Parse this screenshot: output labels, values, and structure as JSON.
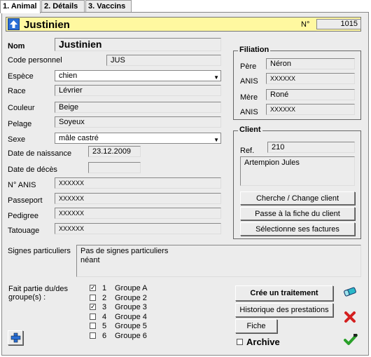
{
  "tabs": [
    {
      "label": "1. Animal"
    },
    {
      "label": "2. Détails"
    },
    {
      "label": "3. Vaccins"
    }
  ],
  "header": {
    "name": "Justinien",
    "number_label": "N°",
    "number_value": "1015"
  },
  "animal": {
    "nom_label": "Nom",
    "nom_value": "Justinien",
    "code_label": "Code personnel",
    "code_value": "JUS",
    "espece_label": "Espèce",
    "espece_value": "chien",
    "race_label": "Race",
    "race_value": "Lévrier",
    "couleur_label": "Couleur",
    "couleur_value": "Beige",
    "pelage_label": "Pelage",
    "pelage_value": "Soyeux",
    "sexe_label": "Sexe",
    "sexe_value": "mâle castré",
    "naissance_label": "Date de naissance",
    "naissance_value": "23.12.2009",
    "deces_label": "Date de décès",
    "deces_value": "",
    "anis_label": "N° ANIS",
    "anis_value": "XXXXXX",
    "passeport_label": "Passeport",
    "passeport_value": "XXXXXX",
    "pedigree_label": "Pedigree",
    "pedigree_value": "XXXXXX",
    "tatouage_label": "Tatouage",
    "tatouage_value": "XXXXXX"
  },
  "filiation": {
    "title": "Filiation",
    "pere_label": "Père",
    "pere_value": "Néron",
    "pere_anis_label": "ANIS",
    "pere_anis_value": "XXXXXX",
    "mere_label": "Mère",
    "mere_value": "Roné",
    "mere_anis_label": "ANIS",
    "mere_anis_value": "XXXXXX"
  },
  "client": {
    "title": "Client",
    "ref_label": "Ref.",
    "ref_value": "210",
    "name": "Artempion Jules",
    "btn_change": "Cherche / Change client",
    "btn_fiche": "Passe à la fiche du client",
    "btn_factures": "Sélectionne ses factures"
  },
  "signes": {
    "label": "Signes particuliers",
    "line1": "Pas de signes particuliers",
    "line2": "néant"
  },
  "groupes": {
    "label_line1": "Fait partie du/des",
    "label_line2": "groupe(s) :",
    "items": [
      {
        "num": "1",
        "name": "Groupe A",
        "checked": true
      },
      {
        "num": "2",
        "name": "Groupe 2",
        "checked": false
      },
      {
        "num": "3",
        "name": "Groupe 3",
        "checked": true
      },
      {
        "num": "4",
        "name": "Groupe 4",
        "checked": false
      },
      {
        "num": "5",
        "name": "Groupe 5",
        "checked": false
      },
      {
        "num": "6",
        "name": "Groupe 6",
        "checked": false
      }
    ]
  },
  "actions": {
    "traitement": "Crée un traitement",
    "historique": "Historique des prestations",
    "fiche": "Fiche",
    "archive": "Archive"
  },
  "icons": {
    "up_arrow": "up-arrow-icon",
    "add": "add-plus-icon",
    "eraser": "eraser-icon",
    "delete": "delete-x-icon",
    "confirm": "checkmark-icon"
  },
  "colors": {
    "title_bg": "#fff8a0",
    "panel_bg": "#ececec",
    "accent_blue": "#2a6fd6",
    "delete_red": "#d42020",
    "confirm_green": "#2aa02a"
  }
}
